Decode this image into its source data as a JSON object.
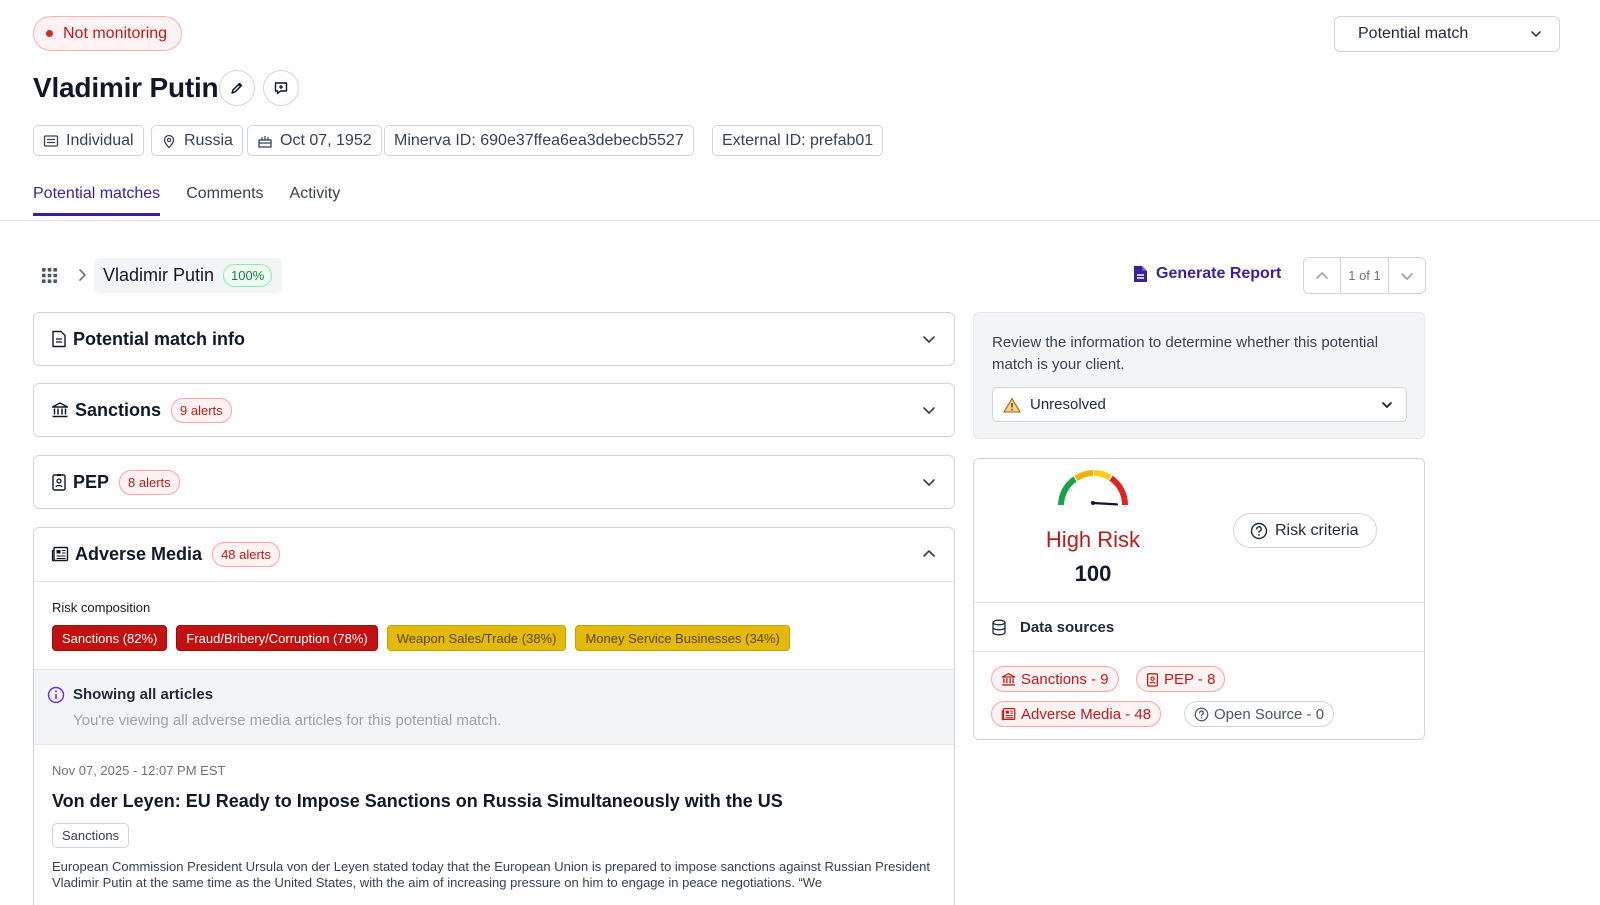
{
  "header": {
    "status_label": "Not monitoring",
    "title": "Vladimir Putin",
    "match_status_select": "Potential match",
    "chips": {
      "type": "Individual",
      "country": "Russia",
      "dob": "Oct 07, 1952",
      "minerva_id": "Minerva ID: 690e37ffea6ea3debecb5527",
      "external_id": "External ID: prefab01"
    }
  },
  "tabs": [
    {
      "label": "Potential matches",
      "active": true
    },
    {
      "label": "Comments",
      "active": false
    },
    {
      "label": "Activity",
      "active": false
    }
  ],
  "breadcrumb": {
    "name": "Vladimir Putin",
    "match_percent": "100%"
  },
  "toolbar": {
    "generate_report": "Generate Report",
    "pager_text": "1 of 1"
  },
  "sections": {
    "match_info": {
      "title": "Potential match info"
    },
    "sanctions": {
      "title": "Sanctions",
      "alerts": "9 alerts"
    },
    "pep": {
      "title": "PEP",
      "alerts": "8 alerts"
    },
    "adverse_media": {
      "title": "Adverse Media",
      "alerts": "48 alerts",
      "risk_composition_label": "Risk composition",
      "risk_tags": [
        {
          "label": "Sanctions (82%)",
          "color": "#c11111"
        },
        {
          "label": "Fraud/Bribery/Corruption (78%)",
          "color": "#c11111"
        },
        {
          "label": "Weapon Sales/Trade (38%)",
          "color": "#e3b90c"
        },
        {
          "label": "Money Service Businesses (34%)",
          "color": "#e3b90c"
        }
      ],
      "info_title": "Showing all articles",
      "info_subtitle": "You're viewing all adverse media articles for this potential match.",
      "article": {
        "date": "Nov 07, 2025 - 12:07 PM EST",
        "title": "Von der Leyen: EU Ready to Impose Sanctions on Russia Simultaneously with the US",
        "tag": "Sanctions",
        "body": "European Commission President Ursula von der Leyen stated today that the European Union is prepared to impose sanctions against Russian President Vladimir Putin at the same time as the United States, with the aim of increasing pressure on him to engage in peace negotiations. “We"
      }
    }
  },
  "review": {
    "text": "Review the information to determine whether this potential match is your client.",
    "resolution": "Unresolved"
  },
  "risk": {
    "level": "High Risk",
    "score": "100",
    "score_value": 100,
    "criteria_button": "Risk criteria"
  },
  "data_sources": {
    "title": "Data sources",
    "sanctions": "Sanctions - 9",
    "pep": "PEP - 8",
    "adverse_media": "Adverse Media - 48",
    "open_source": "Open Source - 0"
  },
  "colors": {
    "accent": "#3b1f9e",
    "danger": "#b91c1c",
    "warning": "#e3b90c",
    "success": "#15803d"
  }
}
